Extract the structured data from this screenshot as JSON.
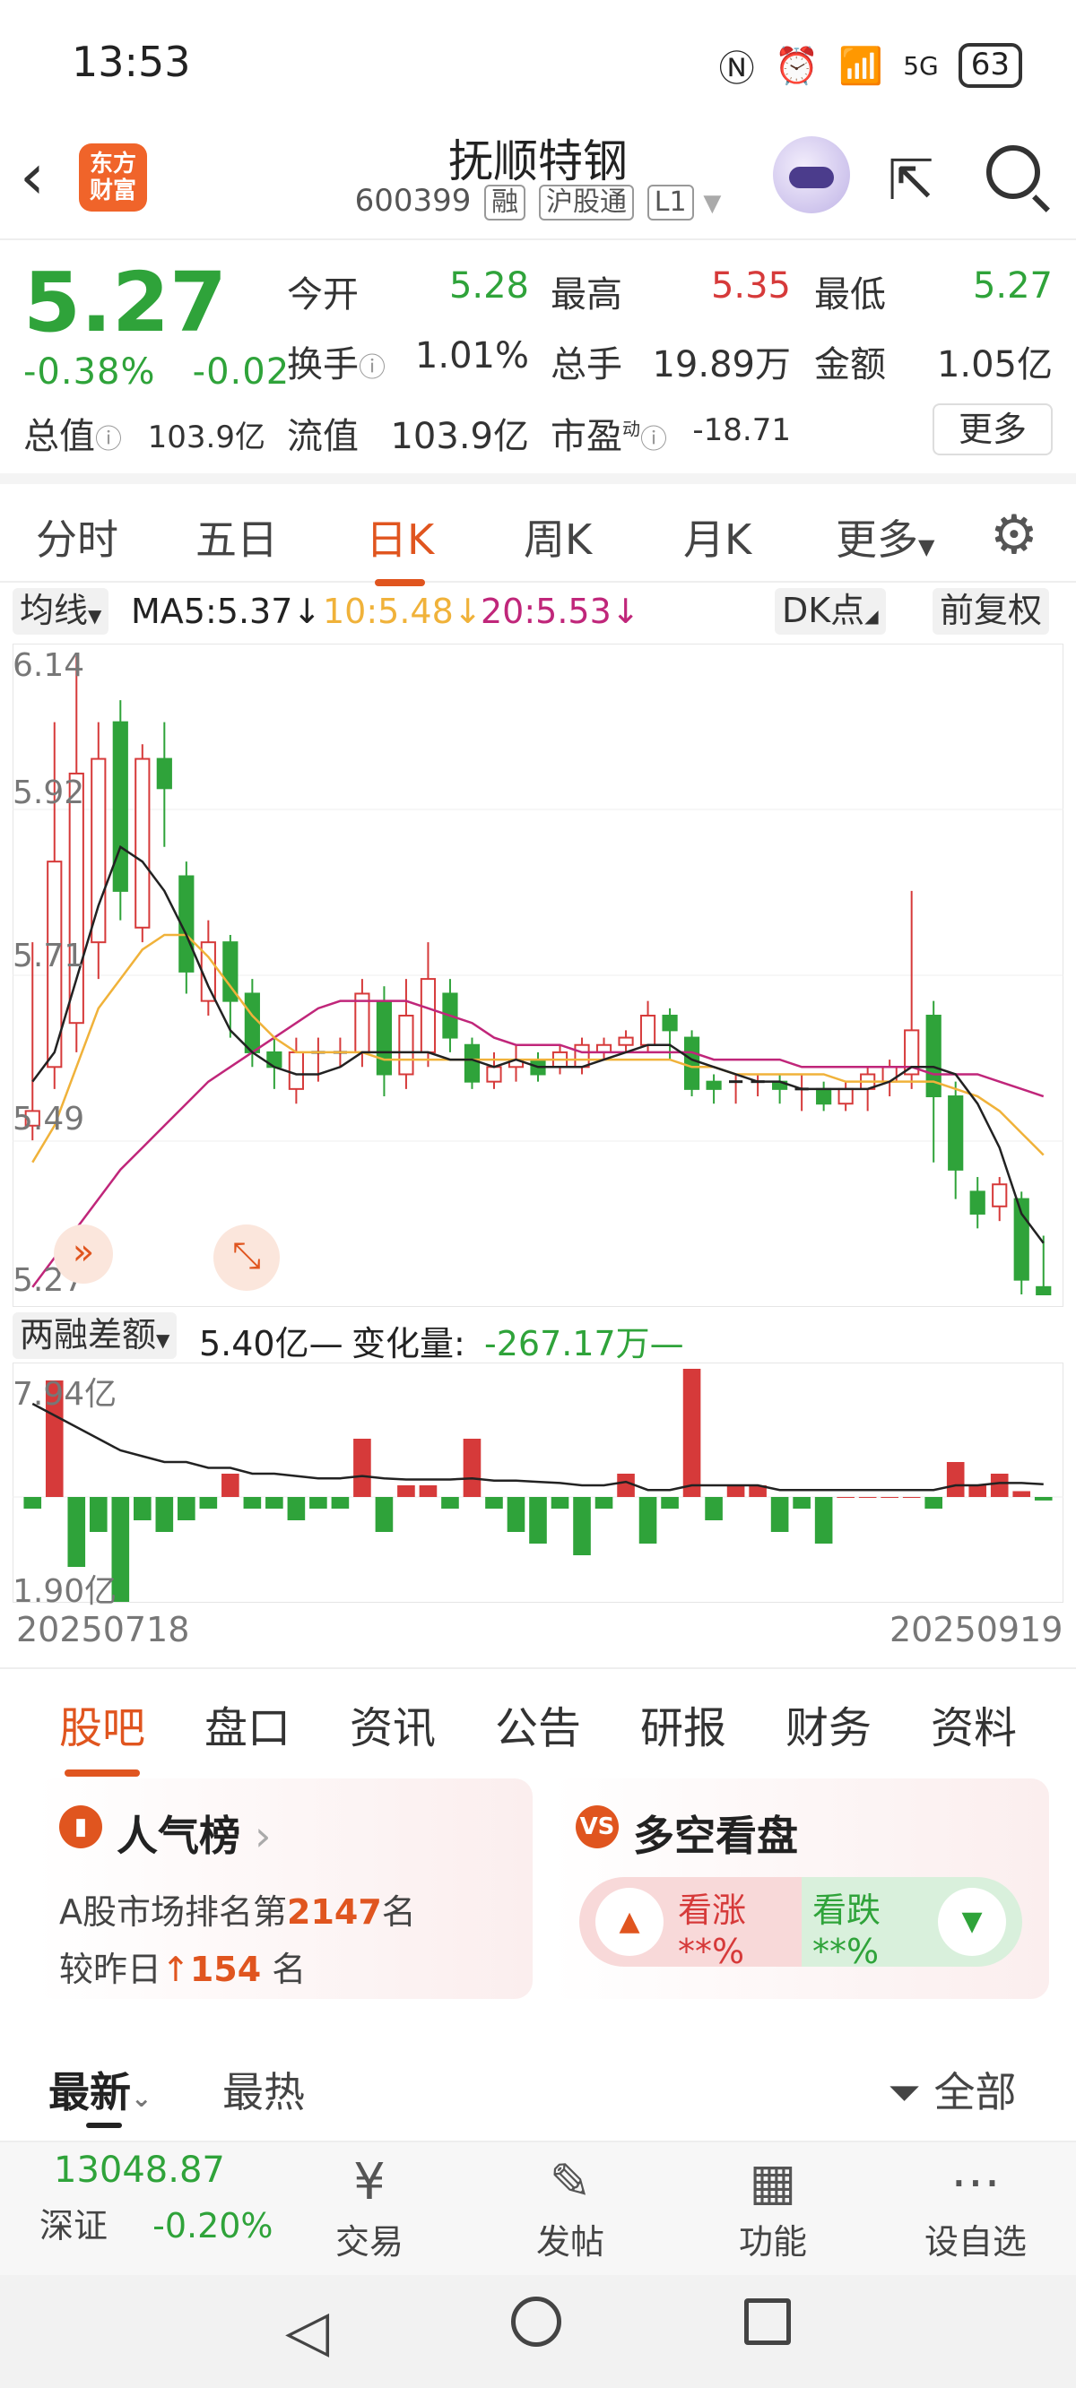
{
  "status_bar": {
    "time": "13:53",
    "signal": "5G",
    "battery": "63"
  },
  "header": {
    "logo_text": "东方财富",
    "stock_name": "抚顺特钢",
    "stock_code": "600399",
    "tags": [
      "融",
      "沪股通",
      "L1"
    ]
  },
  "quote": {
    "price": "5.27",
    "change_pct": "-0.38%",
    "change_amt": "-0.02",
    "open_label": "今开",
    "open": "5.28",
    "high_label": "最高",
    "high": "5.35",
    "low_label": "最低",
    "low": "5.27",
    "turnover_label": "换手",
    "turnover": "1.01%",
    "volume_label": "总手",
    "volume": "19.89万",
    "amount_label": "金额",
    "amount": "1.05亿",
    "mktcap_label": "总值",
    "mktcap": "103.9亿",
    "float_label": "流值",
    "float": "103.9亿",
    "pe_label": "市盈",
    "pe_sup": "动",
    "pe": "-18.71",
    "more": "更多"
  },
  "kline_tabs": {
    "items": [
      "分时",
      "五日",
      "日K",
      "周K",
      "月K",
      "更多"
    ],
    "active": "日K"
  },
  "ma_row": {
    "ma_select": "均线",
    "ma5": "MA5:5.37↓",
    "ma10": "10:5.48↓",
    "ma20": "20:5.53↓",
    "dk": "DK点",
    "adjust": "前复权"
  },
  "margin_row": {
    "select": "两融差额",
    "value": "5.40亿—",
    "change_label": "变化量:",
    "change": "-267.17万—"
  },
  "colors": {
    "up": "#d63a3a",
    "down": "#2fa33a",
    "ma5": "#222222",
    "ma10": "#f0b23a",
    "ma20": "#c0267a",
    "accent": "#e0551f"
  },
  "chart_data": [
    {
      "type": "candlestick",
      "title": "日K",
      "y_ticks": [
        "6.14",
        "5.92",
        "5.71",
        "5.49",
        "5.27"
      ],
      "ylim": [
        5.27,
        6.14
      ],
      "candles": [
        [
          5.5,
          5.52,
          5.48,
          5.75
        ],
        [
          5.58,
          5.86,
          5.55,
          6.05
        ],
        [
          5.64,
          5.98,
          5.6,
          6.14
        ],
        [
          5.75,
          6.0,
          5.7,
          6.05
        ],
        [
          6.05,
          5.82,
          5.78,
          6.08
        ],
        [
          5.77,
          6.0,
          5.75,
          6.02
        ],
        [
          6.0,
          5.96,
          5.88,
          6.05
        ],
        [
          5.84,
          5.71,
          5.68,
          5.86
        ],
        [
          5.67,
          5.75,
          5.65,
          5.78
        ],
        [
          5.75,
          5.67,
          5.62,
          5.76
        ],
        [
          5.68,
          5.6,
          5.58,
          5.7
        ],
        [
          5.6,
          5.58,
          5.55,
          5.62
        ],
        [
          5.55,
          5.6,
          5.53,
          5.62
        ],
        [
          5.6,
          5.6,
          5.56,
          5.62
        ],
        [
          5.6,
          5.6,
          5.58,
          5.62
        ],
        [
          5.6,
          5.68,
          5.58,
          5.7
        ],
        [
          5.67,
          5.57,
          5.54,
          5.69
        ],
        [
          5.57,
          5.65,
          5.55,
          5.7
        ],
        [
          5.6,
          5.7,
          5.58,
          5.75
        ],
        [
          5.68,
          5.62,
          5.6,
          5.7
        ],
        [
          5.61,
          5.56,
          5.55,
          5.62
        ],
        [
          5.56,
          5.58,
          5.55,
          5.6
        ],
        [
          5.58,
          5.59,
          5.56,
          5.61
        ],
        [
          5.59,
          5.57,
          5.56,
          5.6
        ],
        [
          5.58,
          5.6,
          5.57,
          5.61
        ],
        [
          5.58,
          5.61,
          5.57,
          5.62
        ],
        [
          5.6,
          5.61,
          5.59,
          5.62
        ],
        [
          5.61,
          5.62,
          5.6,
          5.63
        ],
        [
          5.61,
          5.65,
          5.6,
          5.67
        ],
        [
          5.65,
          5.63,
          5.59,
          5.66
        ],
        [
          5.62,
          5.55,
          5.54,
          5.63
        ],
        [
          5.56,
          5.55,
          5.53,
          5.57
        ],
        [
          5.56,
          5.56,
          5.53,
          5.57
        ],
        [
          5.56,
          5.56,
          5.54,
          5.57
        ],
        [
          5.56,
          5.55,
          5.53,
          5.57
        ],
        [
          5.55,
          5.55,
          5.52,
          5.57
        ],
        [
          5.55,
          5.53,
          5.52,
          5.56
        ],
        [
          5.53,
          5.55,
          5.52,
          5.56
        ],
        [
          5.55,
          5.57,
          5.52,
          5.58
        ],
        [
          5.56,
          5.58,
          5.54,
          5.59
        ],
        [
          5.57,
          5.63,
          5.55,
          5.82
        ],
        [
          5.65,
          5.54,
          5.45,
          5.67
        ],
        [
          5.54,
          5.44,
          5.4,
          5.56
        ],
        [
          5.41,
          5.38,
          5.36,
          5.43
        ],
        [
          5.39,
          5.42,
          5.37,
          5.43
        ],
        [
          5.4,
          5.29,
          5.27,
          5.41
        ],
        [
          5.28,
          5.27,
          5.27,
          5.35
        ]
      ],
      "ma5": [
        5.56,
        5.6,
        5.7,
        5.8,
        5.88,
        5.86,
        5.82,
        5.76,
        5.69,
        5.63,
        5.6,
        5.58,
        5.57,
        5.57,
        5.58,
        5.6,
        5.6,
        5.6,
        5.6,
        5.59,
        5.59,
        5.58,
        5.59,
        5.58,
        5.58,
        5.58,
        5.59,
        5.6,
        5.61,
        5.61,
        5.59,
        5.58,
        5.57,
        5.56,
        5.56,
        5.55,
        5.55,
        5.55,
        5.55,
        5.56,
        5.58,
        5.58,
        5.57,
        5.53,
        5.47,
        5.38,
        5.34
      ],
      "ma10": [
        5.45,
        5.5,
        5.58,
        5.66,
        5.7,
        5.74,
        5.76,
        5.76,
        5.73,
        5.69,
        5.65,
        5.62,
        5.6,
        5.6,
        5.6,
        5.6,
        5.59,
        5.59,
        5.59,
        5.59,
        5.59,
        5.59,
        5.59,
        5.59,
        5.59,
        5.59,
        5.59,
        5.59,
        5.59,
        5.59,
        5.58,
        5.58,
        5.57,
        5.57,
        5.57,
        5.57,
        5.57,
        5.56,
        5.56,
        5.56,
        5.56,
        5.56,
        5.55,
        5.54,
        5.52,
        5.49,
        5.46
      ],
      "ma20": [
        5.28,
        5.32,
        5.36,
        5.4,
        5.44,
        5.47,
        5.5,
        5.53,
        5.56,
        5.58,
        5.6,
        5.62,
        5.64,
        5.66,
        5.67,
        5.67,
        5.67,
        5.67,
        5.66,
        5.65,
        5.64,
        5.62,
        5.61,
        5.61,
        5.61,
        5.6,
        5.6,
        5.6,
        5.6,
        5.6,
        5.6,
        5.59,
        5.59,
        5.59,
        5.59,
        5.58,
        5.58,
        5.58,
        5.58,
        5.58,
        5.58,
        5.57,
        5.57,
        5.57,
        5.56,
        5.55,
        5.54
      ]
    },
    {
      "type": "bar",
      "title": "两融差额",
      "y_ticks": [
        "7.94亿",
        "1.90亿"
      ],
      "x_range": [
        "20250718",
        "20250919"
      ],
      "values": [
        -1,
        10,
        -6,
        -3,
        -9,
        -2,
        -3,
        -2,
        -1,
        2,
        -1,
        -1,
        -2,
        -1,
        -1,
        5,
        -3,
        1,
        1,
        -1,
        5,
        -1,
        -3,
        -4,
        -1,
        -5,
        -1,
        2,
        -4,
        -1,
        11,
        -2,
        1,
        1,
        -3,
        -1,
        -4,
        0,
        0,
        0,
        0,
        -1,
        3,
        1,
        2,
        0.5,
        -0.3
      ],
      "line": [
        8,
        7,
        6,
        5,
        4,
        3.5,
        3,
        3,
        2.5,
        2.5,
        2,
        2,
        1.8,
        1.6,
        1.6,
        1.8,
        1.6,
        1.5,
        1.5,
        1.5,
        1.6,
        1.4,
        1.4,
        1.3,
        1.2,
        1,
        1,
        1.3,
        0.6,
        0.6,
        1,
        1,
        1,
        1,
        0.6,
        0.6,
        0.6,
        0.6,
        0.6,
        0.6,
        0.6,
        0.6,
        1,
        1,
        1.2,
        1.2,
        1.1
      ]
    }
  ],
  "bottom_tabs": {
    "items": [
      "股吧",
      "盘口",
      "资讯",
      "公告",
      "研报",
      "财务",
      "资料"
    ],
    "active": "股吧"
  },
  "popularity_card": {
    "title": "人气榜",
    "line1_prefix": "A股市场排名第",
    "rank": "2147",
    "line1_suffix": "名",
    "line2_prefix": "较昨日",
    "rank_change": "154",
    "line2_suffix": "名"
  },
  "sentiment_card": {
    "title": "多空看盘",
    "bull_label": "看涨",
    "bull_value": "**%",
    "bear_label": "看跌",
    "bear_value": "**%"
  },
  "sort_row": {
    "latest": "最新",
    "hot": "最热",
    "filter": "全部"
  },
  "bottom_nav": {
    "index_value": "13048.87",
    "index_name": "深证",
    "index_change": "-0.20%",
    "items": [
      "交易",
      "发帖",
      "功能",
      "设自选"
    ]
  }
}
